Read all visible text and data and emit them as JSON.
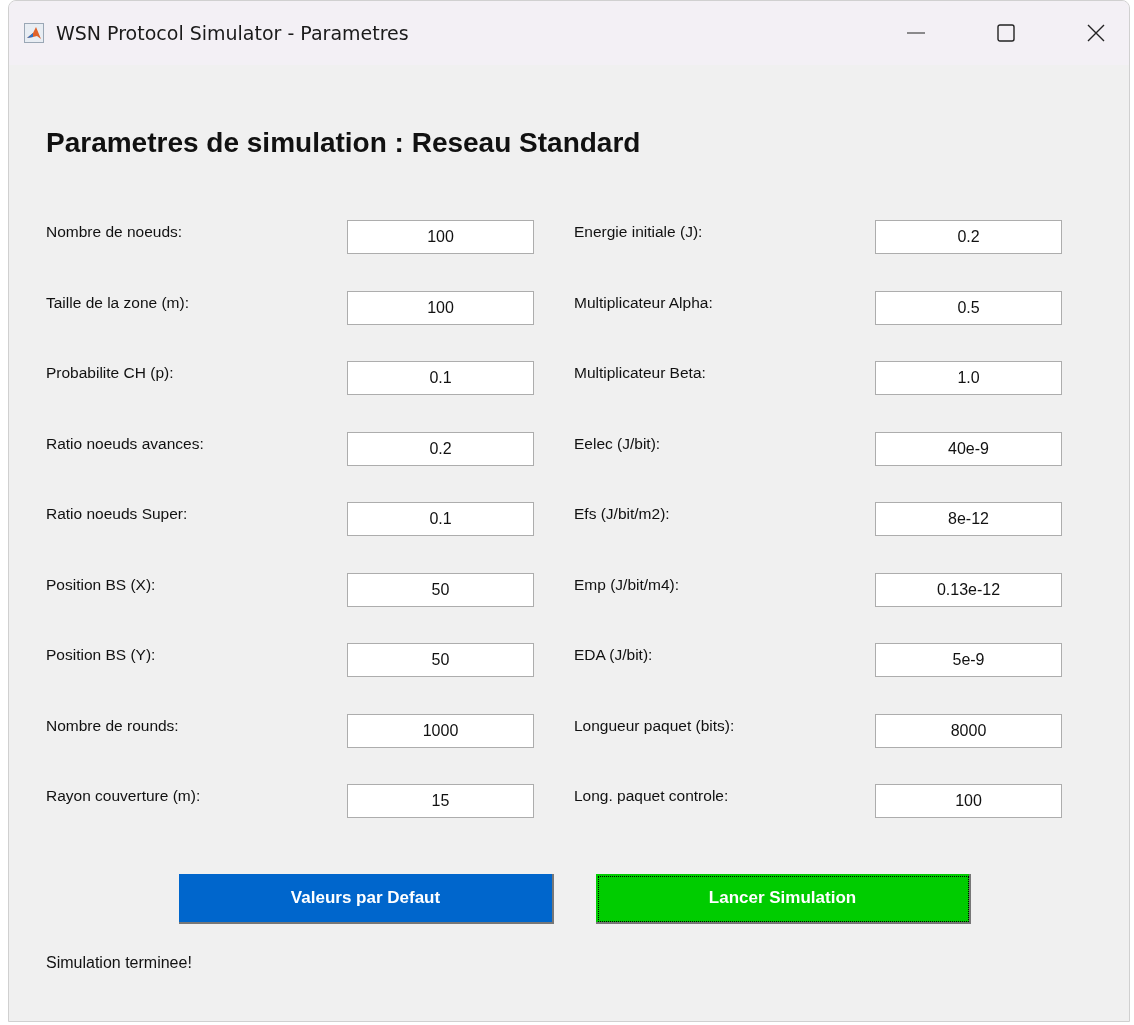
{
  "window": {
    "title": "WSN Protocol Simulator - Parametres"
  },
  "heading": "Parametres de simulation : Reseau Standard",
  "left_params": [
    {
      "label": "Nombre de noeuds:",
      "value": "100"
    },
    {
      "label": "Taille de la zone (m):",
      "value": "100"
    },
    {
      "label": "Probabilite CH (p):",
      "value": "0.1"
    },
    {
      "label": "Ratio noeuds avances:",
      "value": "0.2"
    },
    {
      "label": "Ratio noeuds Super:",
      "value": "0.1"
    },
    {
      "label": "Position BS (X):",
      "value": "50"
    },
    {
      "label": "Position BS (Y):",
      "value": "50"
    },
    {
      "label": "Nombre de rounds:",
      "value": "1000"
    },
    {
      "label": "Rayon couverture (m):",
      "value": "15"
    }
  ],
  "right_params": [
    {
      "label": "Energie initiale (J):",
      "value": "0.2"
    },
    {
      "label": "Multiplicateur Alpha:",
      "value": "0.5"
    },
    {
      "label": "Multiplicateur Beta:",
      "value": "1.0"
    },
    {
      "label": "Eelec (J/bit):",
      "value": "40e-9"
    },
    {
      "label": "Efs (J/bit/m2):",
      "value": "8e-12"
    },
    {
      "label": "Emp (J/bit/m4):",
      "value": "0.13e-12"
    },
    {
      "label": "EDA (J/bit):",
      "value": "5e-9"
    },
    {
      "label": "Longueur paquet (bits):",
      "value": "8000"
    },
    {
      "label": "Long. paquet controle:",
      "value": "100"
    }
  ],
  "buttons": [
    {
      "label": "Valeurs par Defaut",
      "color": "#0066cc",
      "focused": false
    },
    {
      "label": "Lancer Simulation",
      "color": "#00cc00",
      "focused": true
    }
  ],
  "status": "Simulation terminee!"
}
